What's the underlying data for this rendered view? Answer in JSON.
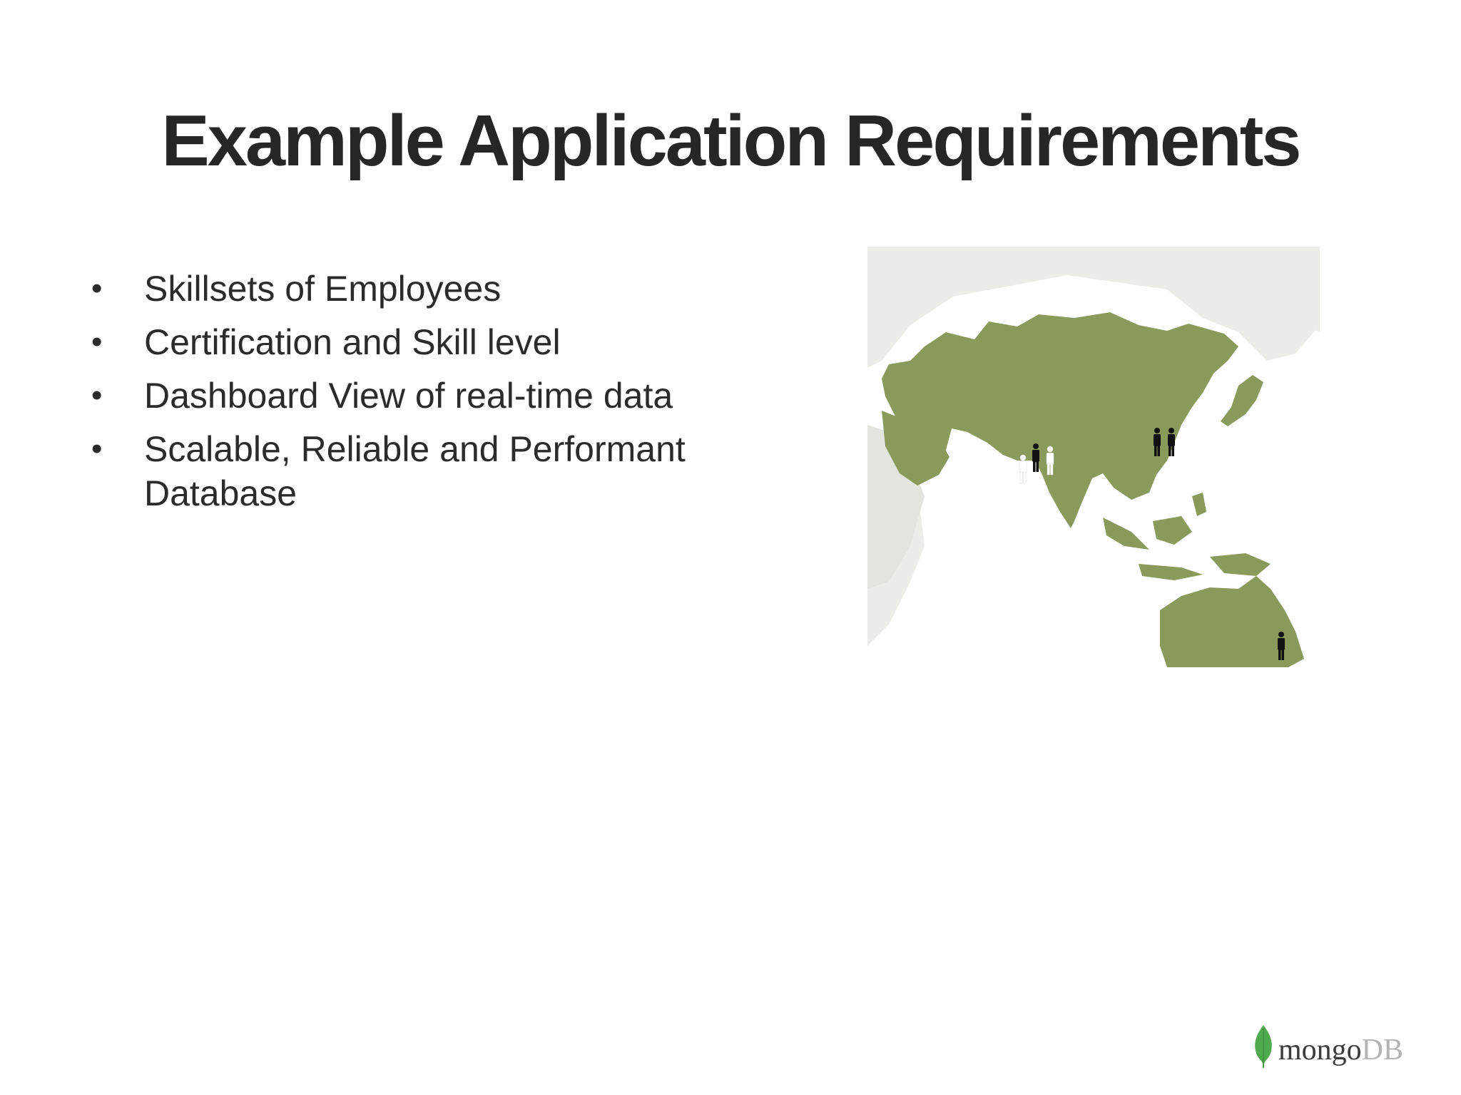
{
  "slide": {
    "title": "Example Application Requirements",
    "bullets": [
      "Skillsets of Employees",
      "Certification and Skill level",
      "Dashboard View of real-time data",
      "Scalable, Reliable and Performant Database"
    ],
    "bullet_glyph": "•"
  },
  "map": {
    "land_color": "#8a9a5b",
    "background_land_color": "#ecece8",
    "markers": [
      {
        "region": "India",
        "people": [
          "white",
          "black",
          "white"
        ]
      },
      {
        "region": "China",
        "people": [
          "black",
          "black"
        ]
      },
      {
        "region": "Australia",
        "people": [
          "black"
        ]
      }
    ]
  },
  "logo": {
    "part1": "mongo",
    "part2": "DB",
    "leaf_color": "#4fa94d"
  }
}
